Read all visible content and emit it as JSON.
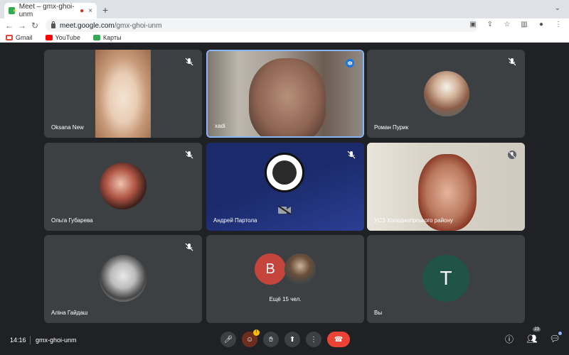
{
  "browser": {
    "tab_title": "Meet – gmx-ghoi-unm",
    "tab_close": "×",
    "new_tab": "+",
    "url_domain": "meet.google.com",
    "url_path": "/gmx-ghoi-unm",
    "bookmarks": [
      {
        "label": "Gmail",
        "icon": "gmail-icon"
      },
      {
        "label": "YouTube",
        "icon": "youtube-icon"
      },
      {
        "label": "Карты",
        "icon": "maps-icon"
      }
    ]
  },
  "tiles": [
    {
      "name": "Oksana New",
      "muted": true
    },
    {
      "name": "xadi",
      "speaking": true
    },
    {
      "name": "Роман Пурик",
      "muted": true
    },
    {
      "name": "Ольга Губарева",
      "muted": true
    },
    {
      "name": "Андрей Партола",
      "muted": true,
      "camera_off": true
    },
    {
      "name": "УСЗ Холодногірського району",
      "muted": true
    },
    {
      "name": "Аліна Гайдаш",
      "muted": true
    },
    {
      "name": "Ещё 15 чел.",
      "avatar_letter": "В"
    },
    {
      "name": "Вы",
      "avatar_letter": "Т"
    }
  ],
  "bottom": {
    "time": "14:16",
    "separator": "|",
    "meeting_code": "gmx-ghoi-unm",
    "participants_count": "23"
  },
  "colors": {
    "background": "#202124",
    "tile": "#3c4043",
    "hangup": "#ea4335",
    "speaking_border": "#8ab4f8"
  }
}
